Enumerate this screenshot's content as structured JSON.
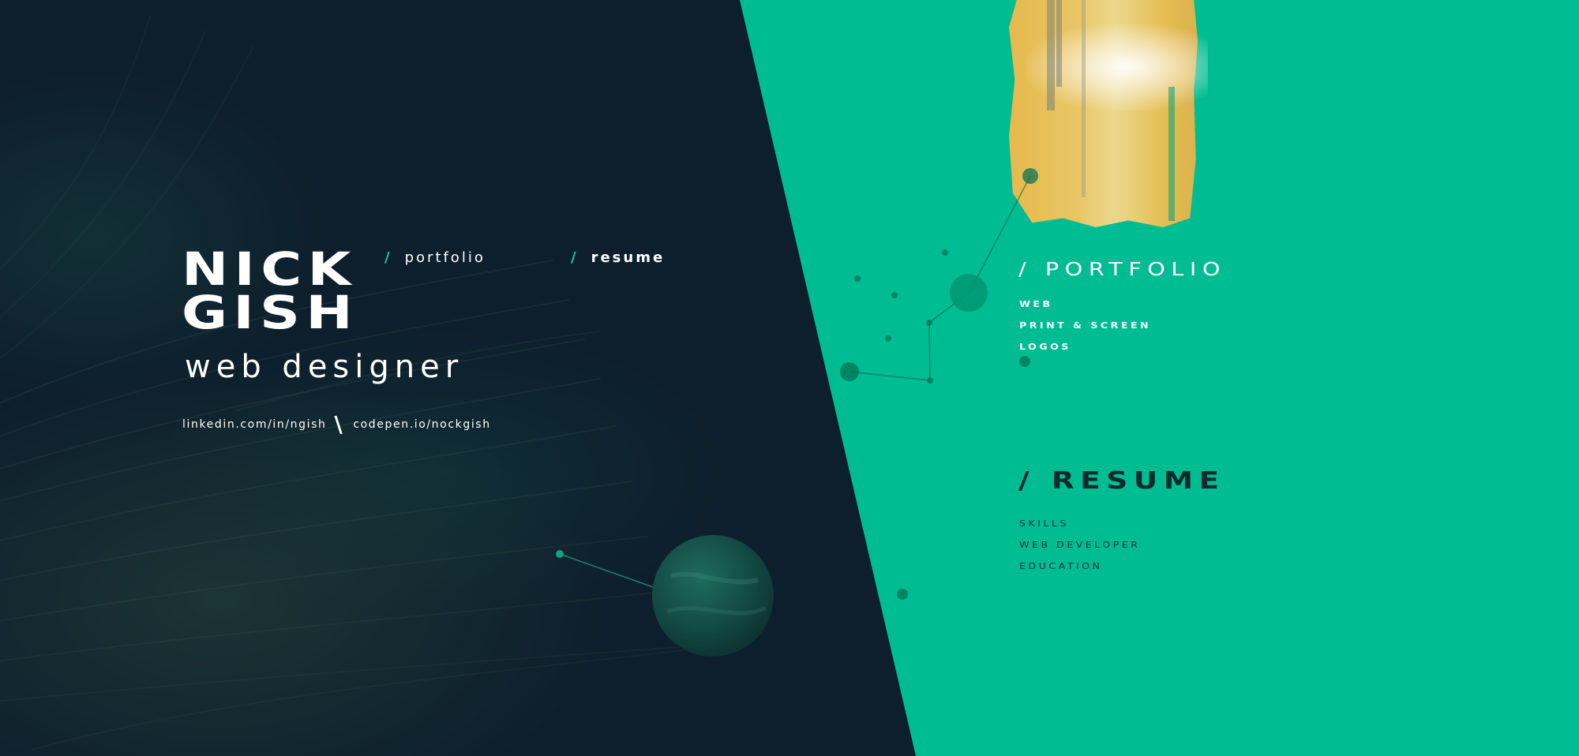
{
  "site": {
    "name_line1": "NICK",
    "name_line2": "GISH",
    "role": "web designer"
  },
  "nav": {
    "slash": "/",
    "items": [
      {
        "label": "portfolio",
        "active": false
      },
      {
        "label": "resume",
        "active": true
      }
    ]
  },
  "links": {
    "linkedin": "linkedin.com/in/ngish",
    "separator": "\\",
    "codepen": "codepen.io/nockgish"
  },
  "portfolio": {
    "heading": "/ PORTFOLIO",
    "items": [
      "WEB",
      "PRINT & SCREEN",
      "LOGOS"
    ]
  },
  "resume": {
    "heading": "/ RESUME",
    "items": [
      "SKILLS",
      "WEB DEVELOPER",
      "EDUCATION"
    ]
  },
  "colors": {
    "dark_background": "#0d1f2c",
    "green_panel": "#00bc92",
    "accent": "#1fc9a0",
    "text_light": "#ffffff",
    "text_dark": "#0d2a2f"
  },
  "icons": [
    "planet-icon",
    "constellation-graphic",
    "paint-brush-graphic"
  ]
}
